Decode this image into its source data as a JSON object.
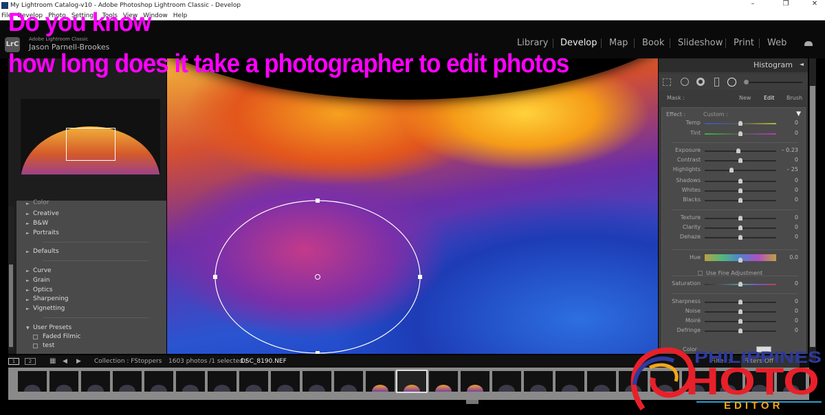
{
  "window": {
    "title": "My Lightroom Catalog-v10 - Adobe Photoshop Lightroom Classic - Develop",
    "menu": [
      "File",
      "Develop",
      "Photo",
      "Settings",
      "Tools",
      "View",
      "Window",
      "Help"
    ]
  },
  "identity": {
    "product": "Adobe Lightroom Classic",
    "user": "Jason Parnell-Brookes",
    "badge": "LrC"
  },
  "modules": [
    {
      "label": "Library"
    },
    {
      "label": "Develop",
      "active": true
    },
    {
      "label": "Map"
    },
    {
      "label": "Book"
    },
    {
      "label": "Slideshow"
    },
    {
      "label": "Print"
    },
    {
      "label": "Web"
    }
  ],
  "overlay": {
    "line1": "Do you know",
    "line2": "how long does it take a photographer to edit photos",
    "color": "#ff00ff"
  },
  "presets": {
    "items": [
      {
        "label": "Color",
        "type": "group"
      },
      {
        "label": "Creative",
        "type": "group"
      },
      {
        "label": "B&W",
        "type": "group"
      },
      {
        "label": "Portraits",
        "type": "group"
      },
      {
        "label": "Defaults",
        "type": "group"
      },
      {
        "label": "Curve",
        "type": "group"
      },
      {
        "label": "Grain",
        "type": "group"
      },
      {
        "label": "Optics",
        "type": "group"
      },
      {
        "label": "Sharpening",
        "type": "group"
      },
      {
        "label": "Vignetting",
        "type": "group"
      },
      {
        "label": "User Presets",
        "type": "open"
      },
      {
        "label": "Faded Filmic",
        "type": "preset"
      },
      {
        "label": "test",
        "type": "preset"
      }
    ]
  },
  "right_panel": {
    "histogram_label": "Histogram",
    "mask": {
      "label": "Mask :",
      "new": "New",
      "edit": "Edit",
      "brush": "Brush"
    },
    "effect": {
      "label": "Effect :",
      "value": "Custom :"
    },
    "sliders": [
      {
        "label": "Temp",
        "value": "0",
        "pos": 0.5,
        "track": "linear-gradient(90deg,#3a5ab8,#555,#b8b83a)"
      },
      {
        "label": "Tint",
        "value": "0",
        "pos": 0.5,
        "track": "linear-gradient(90deg,#3ab83a,#555,#b83ab8)"
      },
      {
        "label": "Exposure",
        "value": "– 0.23",
        "pos": 0.47
      },
      {
        "label": "Contrast",
        "value": "0",
        "pos": 0.5
      },
      {
        "label": "Highlights",
        "value": "– 25",
        "pos": 0.375
      },
      {
        "label": "Shadows",
        "value": "0",
        "pos": 0.5
      },
      {
        "label": "Whites",
        "value": "0",
        "pos": 0.5
      },
      {
        "label": "Blacks",
        "value": "0",
        "pos": 0.5
      },
      {
        "label": "Texture",
        "value": "0",
        "pos": 0.5
      },
      {
        "label": "Clarity",
        "value": "0",
        "pos": 0.5
      },
      {
        "label": "Dehaze",
        "value": "0",
        "pos": 0.5
      },
      {
        "label": "Hue",
        "value": "0.0",
        "pos": 0.5,
        "track": "linear-gradient(90deg,#b8a040,#50b880,#5080d0,#b050c0,#c0a040)"
      },
      {
        "label": "Saturation",
        "value": "0",
        "pos": 0.5,
        "track": "linear-gradient(90deg,#333,#555,#40a0a0,#8050c0,#c04050)"
      },
      {
        "label": "Sharpness",
        "value": "0",
        "pos": 0.5
      },
      {
        "label": "Noise",
        "value": "0",
        "pos": 0.5
      },
      {
        "label": "Moiré",
        "value": "0",
        "pos": 0.5
      },
      {
        "label": "Defringe",
        "value": "0",
        "pos": 0.5
      }
    ],
    "fine_adjust": "Use Fine Adjustment",
    "color_label": "Color"
  },
  "filmstrip": {
    "collection": "Collection : FStoppers",
    "count": "1603 photos /1 selected /",
    "file": "DSC_8190.NEF",
    "filter_label": "Filter :",
    "filter_value": "Filters Off",
    "view1": "1",
    "view2": "2",
    "selected_index": 12,
    "thumb_count": 25
  },
  "logo": {
    "line1": "PHILIPPINES",
    "line2": "HOTO",
    "line3": "EDITOR",
    "colors": {
      "red": "#e8202a",
      "blue": "#2d3aa0",
      "yellow": "#f6a51a"
    }
  }
}
